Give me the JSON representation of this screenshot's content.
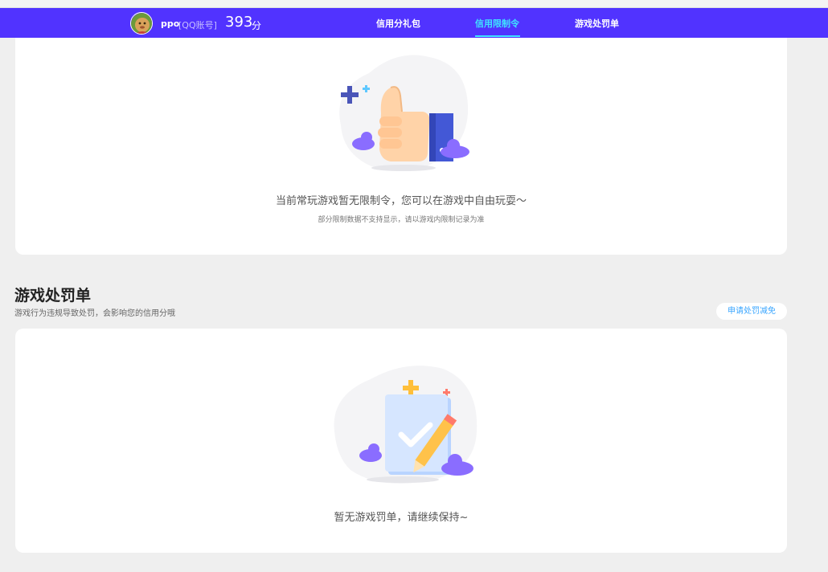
{
  "header": {
    "nickname": "ppo",
    "account_type": "[QQ账号]",
    "score": "393",
    "score_unit": "分"
  },
  "nav": {
    "tabs": [
      {
        "label": "信用分礼包",
        "active": false
      },
      {
        "label": "信用限制令",
        "active": true
      },
      {
        "label": "游戏处罚单",
        "active": false
      }
    ]
  },
  "restriction": {
    "message": "当前常玩游戏暂无限制令，您可以在游戏中自由玩耍～",
    "note": "部分限制数据不支持显示，请以游戏内限制记录为准"
  },
  "penalty": {
    "title": "游戏处罚单",
    "description": "游戏行为违规导致处罚，会影响您的信用分哦",
    "appeal_button": "申请处罚减免",
    "empty_message": "暂无游戏罚单，请继续保持~"
  },
  "colors": {
    "nav_bg": "#5133ff",
    "active_tab": "#3fe3ff",
    "link": "#3aa6ff",
    "page_bg": "#efefef"
  },
  "icons": {
    "restriction_illustration": "thumbs-up-illustration",
    "penalty_illustration": "checklist-pencil-illustration"
  }
}
